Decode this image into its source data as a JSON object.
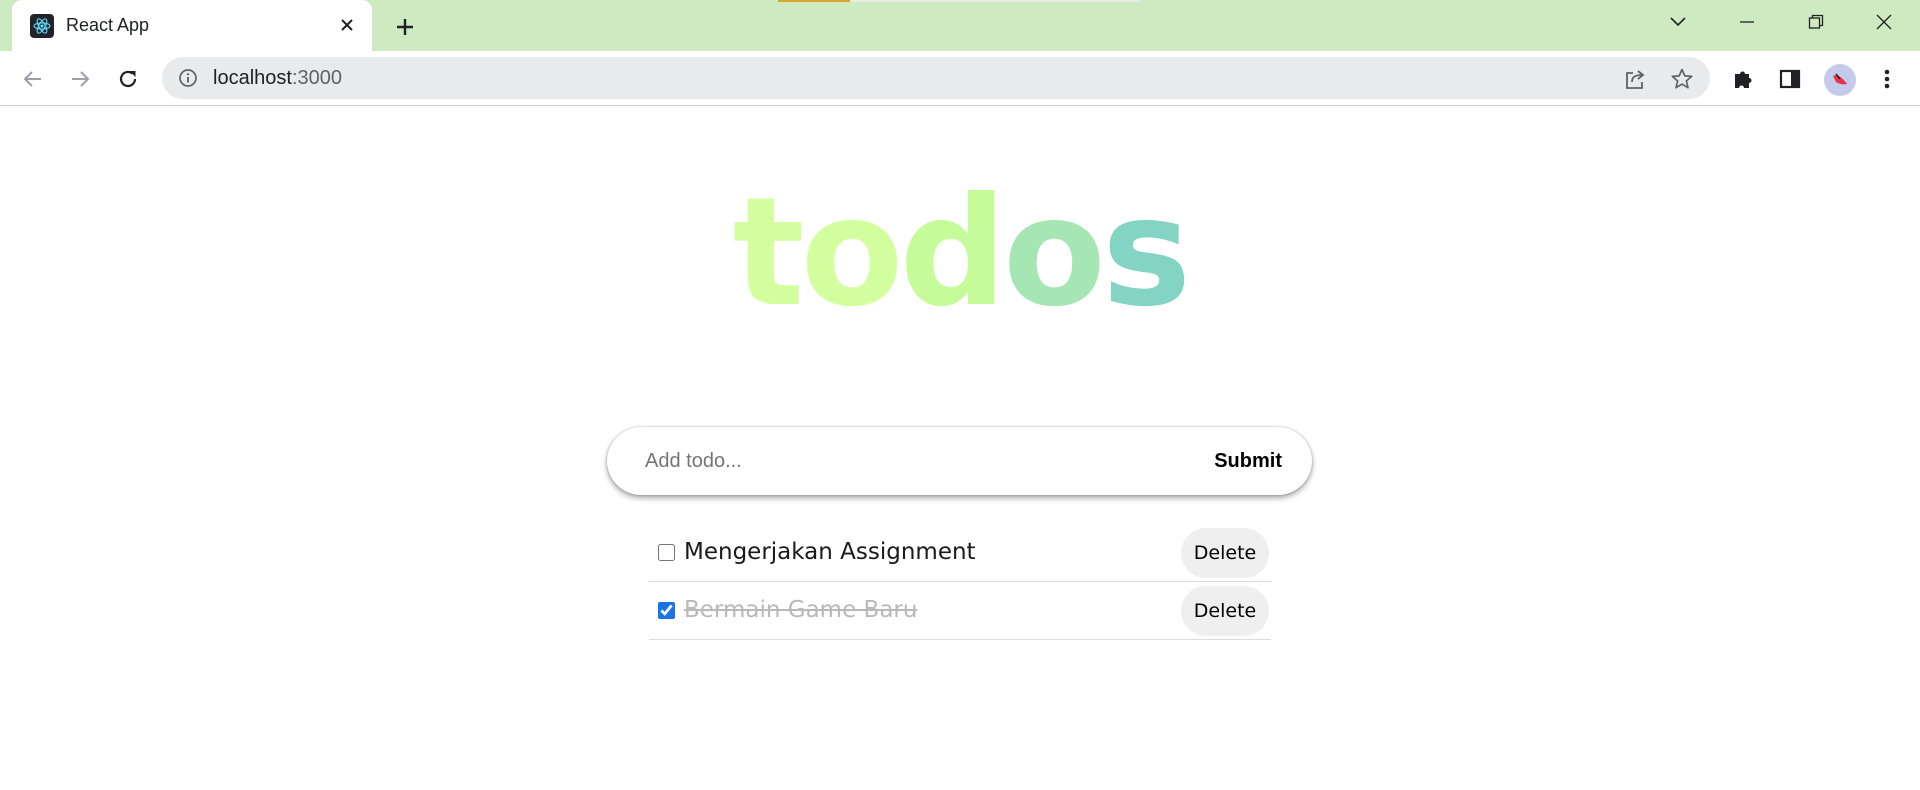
{
  "browser": {
    "tab_title": "React App",
    "url_host": "localhost",
    "url_port": ":3000"
  },
  "app": {
    "logo": [
      "to",
      "d",
      "o",
      "s"
    ],
    "input_placeholder": "Add todo...",
    "input_value": "",
    "submit_label": "Submit",
    "todos": [
      {
        "text": "Mengerjakan Assignment",
        "done": false,
        "delete_label": "Delete"
      },
      {
        "text": "Bermain Game Baru",
        "done": true,
        "delete_label": "Delete"
      }
    ]
  },
  "colors": {
    "tabstrip": "#cdeac0",
    "logo_gradient": [
      "#d3ff9f",
      "#c6fb9a",
      "#a6e6b4",
      "#84d4c4"
    ],
    "checkbox_accent": "#1a73e8"
  }
}
